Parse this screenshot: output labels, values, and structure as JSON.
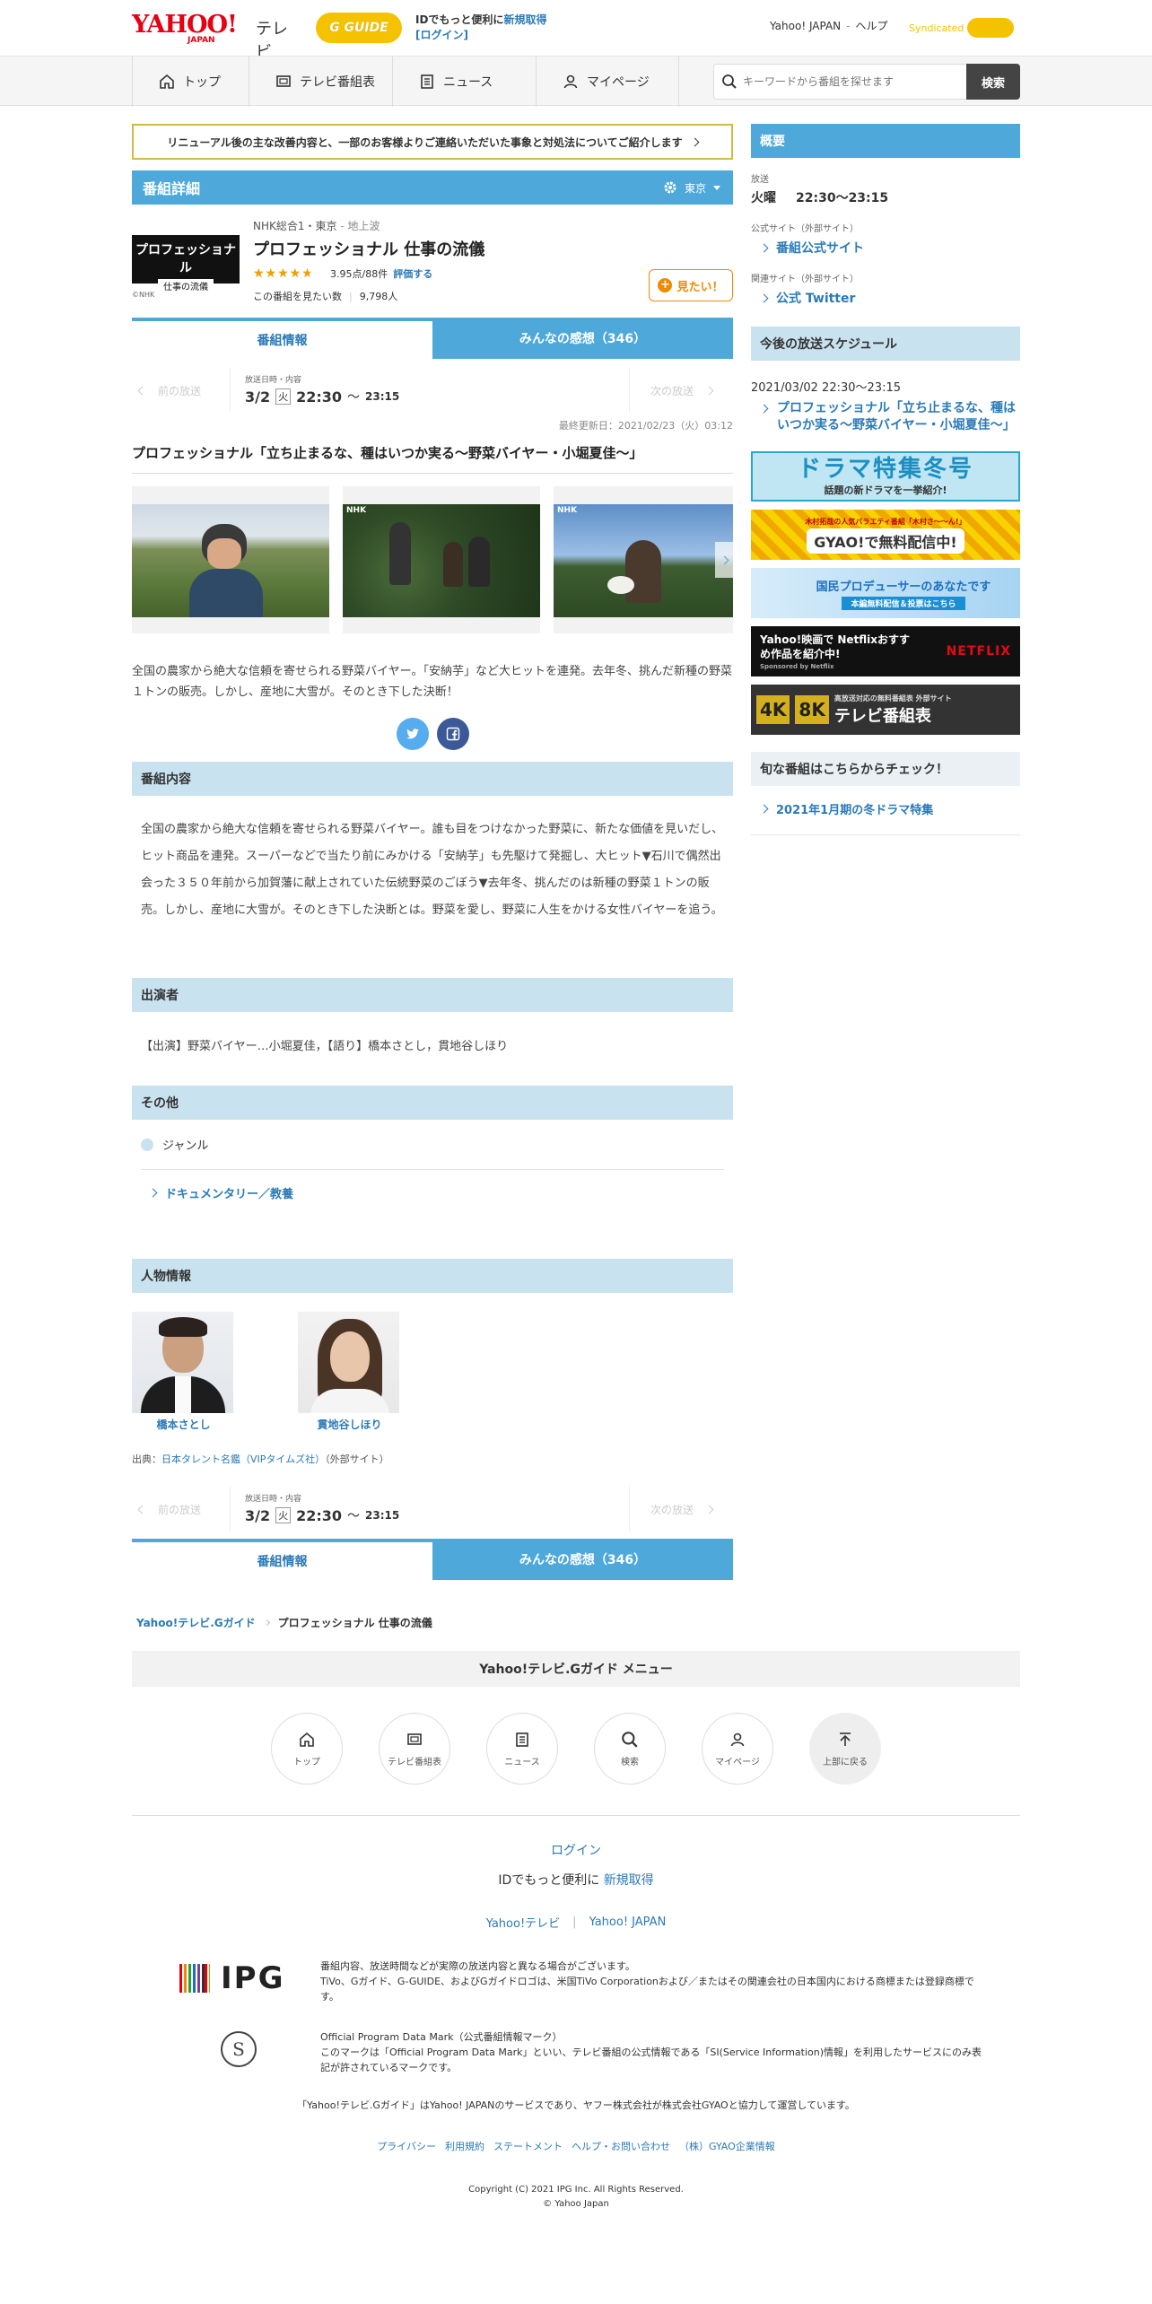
{
  "header": {
    "logo_yahoo": "YAHOO!",
    "logo_japan": "JAPAN",
    "logo_tv": "テレビ",
    "logo_gguide": "G GUIDE",
    "id_promo": "IDでもっと便利に",
    "signup": "新規取得",
    "login": "[ログイン]",
    "yahoo_japan": "Yahoo! JAPAN",
    "help": "ヘルプ",
    "syndicated": "Syndicated"
  },
  "nav": {
    "items": [
      "トップ",
      "テレビ番組表",
      "ニュース",
      "マイページ"
    ],
    "search_placeholder": "キーワードから番組を探せます",
    "search_button": "検索"
  },
  "notice": "リニューアル後の主な改善内容と、一部のお客様よりご連絡いただいた事象と対処法についてご紹介します",
  "detail": {
    "section_title": "番組詳細",
    "region": "東京",
    "channel": "NHK総合1・東京",
    "broadcast_type": "地上波",
    "title": "プロフェッショナル 仕事の流儀",
    "rating": "3.95点/88件",
    "rate_link": "評価する",
    "rating_value": 3.95,
    "want_label": "この番組を見たい数",
    "want_count": "9,798人",
    "want_button": "見たい！",
    "thumb_text": "プロフェッショナル",
    "thumb_sub": "仕事の流儀",
    "nhk": "©NHK"
  },
  "tabs": {
    "info": "番組情報",
    "reviews": "みんなの感想（346）"
  },
  "schedule": {
    "prev": "前の放送",
    "next": "次の放送",
    "label": "放送日時・内容",
    "date": "3/2",
    "dow": "火",
    "start": "22:30",
    "tilde": "〜",
    "end": "23:15"
  },
  "last_updated": "最終更新日：2021/02/23（火）03:12",
  "episode_title": "プロフェッショナル「立ち止まるな、種はいつか実る〜野菜バイヤー・小堀夏佳〜」",
  "photo_labels": [
    "NHK",
    "NHK"
  ],
  "summary": "全国の農家から絶大な信頼を寄せられる野菜バイヤー。「安納芋」など大ヒットを連発。去年冬、挑んだ新種の野菜１トンの販売。しかし、産地に大雪が。そのとき下した決断！",
  "content": {
    "title": "番組内容",
    "text": "全国の農家から絶大な信頼を寄せられる野菜バイヤー。誰も目をつけなかった野菜に、新たな価値を見いだし、ヒット商品を連発。スーパーなどで当たり前にみかける「安納芋」も先駆けて発掘し、大ヒット▼石川で偶然出会った３５０年前から加賀藩に献上されていた伝統野菜のごぼう▼去年冬、挑んだのは新種の野菜１トンの販売。しかし、産地に大雪が。そのとき下した決断とは。野菜を愛し、野菜に人生をかける女性バイヤーを追う。"
  },
  "cast": {
    "title": "出演者",
    "text": "【出演】野菜バイヤー…小堀夏佳，【語り】橋本さとし，貫地谷しほり"
  },
  "other": {
    "title": "その他",
    "genre_label": "ジャンル",
    "genre": "ドキュメンタリー／教養"
  },
  "people": {
    "title": "人物情報",
    "persons": [
      "橋本さとし",
      "貫地谷しほり"
    ],
    "source_label": "出典：",
    "source": "日本タレント名鑑（VIPタイムズ社）",
    "external": "（外部サイト）"
  },
  "breadcrumb": {
    "home": "Yahoo!テレビ.Gガイド",
    "current": "プロフェッショナル 仕事の流儀"
  },
  "menu": {
    "title": "Yahoo!テレビ.Gガイド メニュー",
    "items": [
      "トップ",
      "テレビ番組表",
      "ニュース",
      "検索",
      "マイページ",
      "上部に戻る"
    ]
  },
  "footer": {
    "login": "ログイン",
    "id_promo": "IDでもっと便利に",
    "signup": "新規取得",
    "link1": "Yahoo!テレビ",
    "sep": "|",
    "link2": "Yahoo! JAPAN",
    "ipg_logo": "IPG",
    "ipg_text1": "番組内容、放送時間などが実際の放送内容と異なる場合がございます。",
    "ipg_text2": "TiVo、Gガイド、G-GUIDE、およびGガイドロゴは、米国TiVo Corporationおよび／またはその関連会社の日本国内における商標または登録商標です。",
    "opd_title": "Official Program Data Mark（公式番組情報マーク）",
    "opd_text": "このマークは「Official Program Data Mark」といい、テレビ番組の公式情報である「SI(Service Information)情報」を利用したサービスにのみ表記が許されているマークです。",
    "notice": "「Yahoo!テレビ.Gガイド」はYahoo! JAPANのサービスであり、ヤフー株式会社が株式会社GYAOと協力して運営しています。",
    "links": [
      "プライバシー",
      "利用規約",
      "ステートメント",
      "ヘルプ・お問い合わせ",
      "（株）GYAO企業情報"
    ],
    "copyright1": "Copyright (C) 2021 IPG Inc. All Rights Reserved.",
    "copyright2": "© Yahoo Japan"
  },
  "sidebar": {
    "overview": "概要",
    "broadcast_label": "放送",
    "broadcast_dow": "火曜",
    "broadcast_time": "22:30〜23:15",
    "official_label": "公式サイト（外部サイト）",
    "official_link": "番組公式サイト",
    "related_label": "関連サイト（外部サイト）",
    "twitter_link": "公式 Twitter",
    "upcoming_title": "今後の放送スケジュール",
    "upcoming_date": "2021/03/02 22:30〜23:15",
    "upcoming_link": "プロフェッショナル「立ち止まるな、種はいつか実る〜野菜バイヤー・小堀夏佳〜」",
    "banner1_main": "ドラマ特集冬号",
    "banner1_sub": "話題の新ドラマを一挙紹介!",
    "banner2_text": "木村拓哉の人気バラエティ番組「木村さ〜〜ん!」",
    "banner2_main": "GYAO!で無料配信中!",
    "banner3_main": "国民プロデューサーのあなたです",
    "banner3_sub": "本編無料配信＆投票はこちら",
    "banner4_main": "Yahoo!映画で Netflixおすすめ作品を紹介中!",
    "banner4_brand": "NETFLIX",
    "banner4_sponsor": "Sponsored by Netflix",
    "banner5_sub": "高放送対応の無料番組表 外部サイト",
    "banner5_main": "テレビ番組表",
    "banner5_4k": "4K",
    "banner5_8k": "8K",
    "seasonal_title": "旬な番組はこちらからチェック！",
    "seasonal_link": "2021年1月期の冬ドラマ特集"
  },
  "colors": {
    "accent": "#4ea8da",
    "link": "#2a7ab8",
    "orange": "#f08a00",
    "light_blue": "#c9e2ef"
  }
}
